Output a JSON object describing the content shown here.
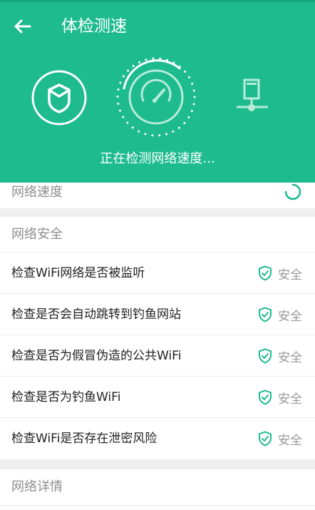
{
  "header": {
    "title": "体检测速",
    "back_icon": "arrow-left-icon",
    "accent_color": "#1dbb8e",
    "status": "正在检测网络速度..."
  },
  "speed": {
    "label": "网络速度"
  },
  "security": {
    "title": "网络安全",
    "items": [
      {
        "label": "检查WiFi网络是否被监听",
        "status": "安全"
      },
      {
        "label": "检查是否会自动跳转到钓鱼网站",
        "status": "安全"
      },
      {
        "label": "检查是否为假冒伪造的公共WiFi",
        "status": "安全"
      },
      {
        "label": "检查是否为钓鱼WiFi",
        "status": "安全"
      },
      {
        "label": "检查WiFi是否存在泄密风险",
        "status": "安全"
      }
    ]
  },
  "details": {
    "title": "网络详情"
  }
}
